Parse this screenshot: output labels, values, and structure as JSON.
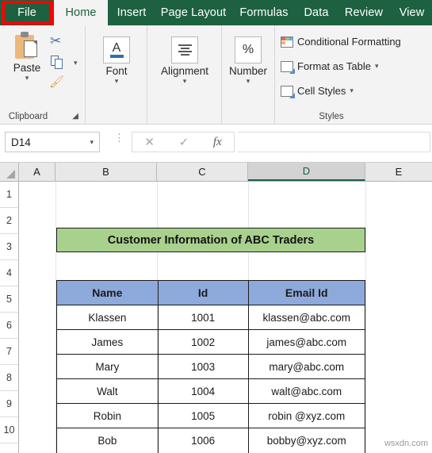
{
  "ribbon": {
    "tabs": [
      {
        "label": "File",
        "state": "file"
      },
      {
        "label": "Home",
        "state": "active"
      },
      {
        "label": "Insert",
        "state": "normal"
      },
      {
        "label": "Page Layout",
        "state": "normal"
      },
      {
        "label": "Formulas",
        "state": "normal"
      },
      {
        "label": "Data",
        "state": "normal"
      },
      {
        "label": "Review",
        "state": "normal"
      },
      {
        "label": "View",
        "state": "normal"
      }
    ],
    "groups": {
      "clipboard": {
        "label": "Clipboard",
        "paste_label": "Paste",
        "icons": [
          "clipboard-paste-icon",
          "cut-scissors-icon",
          "copy-icon",
          "format-painter-icon"
        ]
      },
      "font": {
        "label": "Font",
        "glyph": "A"
      },
      "alignment": {
        "label": "Alignment"
      },
      "number": {
        "label": "Number",
        "glyph": "%"
      },
      "styles": {
        "label": "Styles",
        "items": [
          {
            "label": "Conditional Formatting",
            "has_chevron": false
          },
          {
            "label": "Format as Table",
            "has_chevron": true
          },
          {
            "label": "Cell Styles",
            "has_chevron": true
          }
        ]
      }
    }
  },
  "formula_bar": {
    "name_box_value": "D14",
    "cancel_icon": "cancel-x-icon",
    "enter_icon": "enter-check-icon",
    "function_icon": "fx-icon",
    "formula_value": ""
  },
  "grid": {
    "columns": [
      "A",
      "B",
      "C",
      "D",
      "E"
    ],
    "selected_column": "D",
    "rows": [
      "1",
      "2",
      "3",
      "4",
      "5",
      "6",
      "7",
      "8",
      "9",
      "10"
    ]
  },
  "sheet": {
    "banner_title": "Customer Information of ABC Traders",
    "banner_color": "#a9d18e",
    "header_color": "#8ea9db",
    "table": {
      "headers": [
        "Name",
        "Id",
        "Email Id"
      ],
      "rows": [
        [
          "Klassen",
          "1001",
          "klassen@abc.com"
        ],
        [
          "James",
          "1002",
          "james@abc.com"
        ],
        [
          "Mary",
          "1003",
          "mary@abc.com"
        ],
        [
          "Walt",
          "1004",
          "walt@abc.com"
        ],
        [
          "Robin",
          "1005",
          "robin @xyz.com"
        ],
        [
          "Bob",
          "1006",
          "bobby@xyz.com"
        ]
      ]
    }
  },
  "watermark": "wsxdn.com"
}
